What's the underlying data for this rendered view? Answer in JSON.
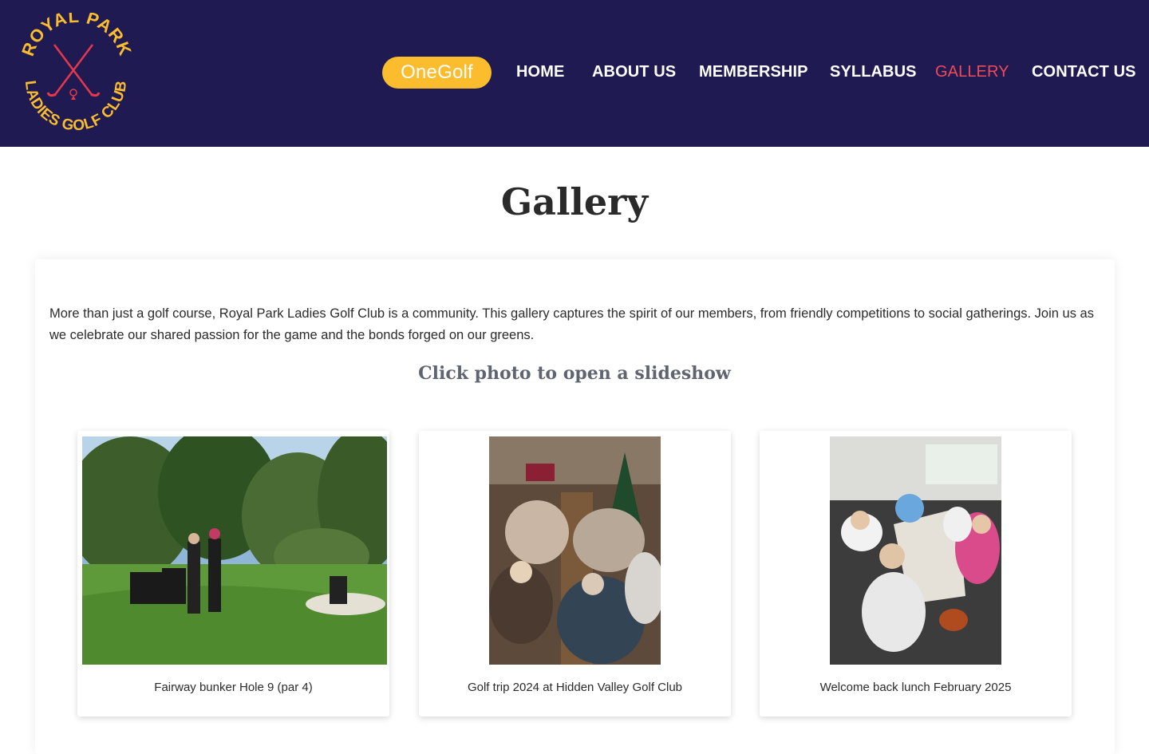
{
  "logo": {
    "top_text": "ROYAL PARK",
    "bottom_text": "LADIES GOLF CLUB",
    "colors": {
      "text": "#fbbd2e",
      "clubs": "#e8384b"
    }
  },
  "nav": {
    "onegolf": "OneGolf",
    "items": [
      "HOME",
      "ABOUT US",
      "MEMBERSHIP",
      "SYLLABUS",
      "GALLERY",
      "CONTACT US"
    ],
    "active": "GALLERY"
  },
  "page": {
    "title": "Gallery",
    "intro": "More than just a golf course, Royal Park Ladies Golf Club is a community. This gallery captures the spirit of our members, from friendly competitions to social gatherings. Join us as we celebrate our shared passion for the game and the bonds forged on our greens.",
    "subtitle": "Click photo to open a slideshow"
  },
  "gallery": [
    {
      "caption": "Fairway bunker Hole 9 (par 4)"
    },
    {
      "caption": "Golf trip 2024 at Hidden Valley Golf Club"
    },
    {
      "caption": "Welcome back lunch February 2025"
    }
  ],
  "colors": {
    "header_bg": "#1f1a52",
    "onegolf_bg": "#fbbd2e",
    "nav_active": "#ef4a58"
  }
}
